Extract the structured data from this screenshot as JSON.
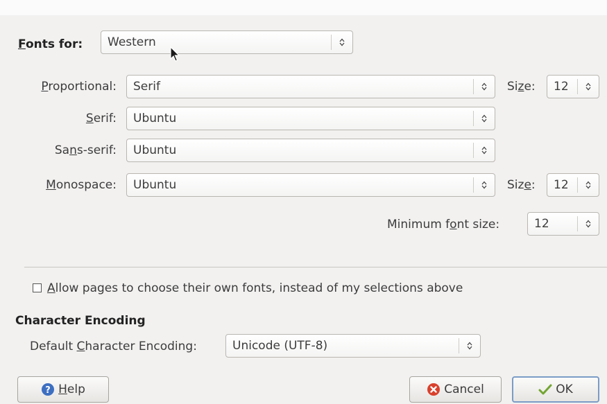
{
  "fonts_for": {
    "label": "Fonts for:",
    "accel": "F",
    "label_rest": "onts for:",
    "value": "Western"
  },
  "rows": {
    "proportional": {
      "label_pre": "",
      "accel": "P",
      "label_post": "roportional:",
      "value": "Serif"
    },
    "serif": {
      "label_pre": "",
      "accel": "S",
      "label_post": "erif:",
      "value": "Ubuntu"
    },
    "sans": {
      "label_pre": "Sa",
      "accel": "n",
      "label_post": "s-serif:",
      "value": "Ubuntu"
    },
    "mono": {
      "label_pre": "",
      "accel": "M",
      "label_post": "onospace:",
      "value": "Ubuntu"
    }
  },
  "size1": {
    "label_pre": "Si",
    "accel": "z",
    "label_post": "e:",
    "value": "12"
  },
  "size2": {
    "label_pre": "Siz",
    "accel": "e",
    "label_post": ":",
    "value": "12"
  },
  "min_size": {
    "label_pre": "Minimum f",
    "accel": "o",
    "label_post": "nt size:",
    "value": "12"
  },
  "allow_fonts": {
    "accel": "A",
    "label_rest": "llow pages to choose their own fonts, instead of my selections above",
    "checked": false
  },
  "encoding": {
    "heading": "Character Encoding",
    "label_pre": "Default ",
    "accel": "C",
    "label_post": "haracter Encoding:",
    "value": "Unicode (UTF-8)"
  },
  "buttons": {
    "help": {
      "accel": "H",
      "rest": "elp"
    },
    "cancel": "Cancel",
    "ok": "OK"
  },
  "colors": {
    "help_icon": "#3d6fc1",
    "cancel_icon": "#d9412d",
    "ok_icon": "#73a533"
  }
}
